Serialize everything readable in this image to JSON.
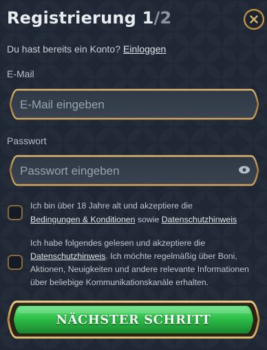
{
  "header": {
    "title": "Registrierung",
    "step_current": "1",
    "step_separator": "/",
    "step_total": "2",
    "close_icon": "close-icon"
  },
  "login_prompt": {
    "text": "Du hast bereits ein Konto?",
    "link": "Einloggen"
  },
  "email": {
    "label": "E-Mail",
    "placeholder": "E-Mail eingeben",
    "value": ""
  },
  "password": {
    "label": "Passwort",
    "placeholder": "Passwort eingeben",
    "value": "",
    "toggle_icon": "eye-icon"
  },
  "consent_terms": {
    "checked": false,
    "text_before": "Ich bin über 18 Jahre alt und akzeptiere die",
    "link_terms": "Bedingungen & Konditionen",
    "text_middle": "sowie",
    "link_privacy": "Datenschutzhinweis"
  },
  "consent_marketing": {
    "checked": false,
    "text_before": "Ich habe folgendes gelesen und akzeptiere die",
    "link_privacy": "Datenschutzhinweis",
    "text_after": ". Ich möchte regelmäßig über Boni, Aktionen, Neuigkeiten und andere relevante Informationen über beliebige Kommunikationskanäle erhalten."
  },
  "next_button": {
    "label": "NÄCHSTER SCHRITT"
  },
  "colors": {
    "background": "#1b2330",
    "gold_border": "#c79a4a",
    "button_green": "#2fbf4a"
  }
}
